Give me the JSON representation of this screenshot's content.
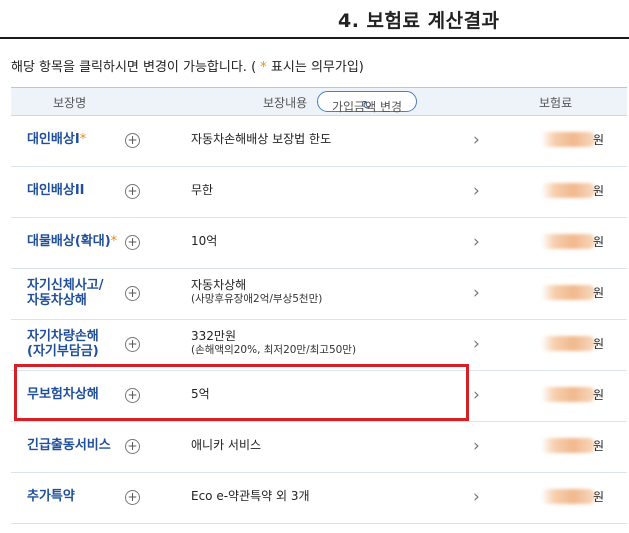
{
  "page_title": "4. 보험료 계산결과",
  "notice": {
    "prefix": "해당 항목을 클릭하시면 변경이 가능합니다. (",
    "star": " *",
    "suffix": " 표시는 의무가입)"
  },
  "table_header": {
    "name": "보장명",
    "content": "보장내용",
    "change_button": "가입금액 변경",
    "premium": "보험료"
  },
  "rows": [
    {
      "name": "대인배상I",
      "required": "*",
      "content": "자동차손해배상 보장법 한도",
      "sub": "",
      "unit": "원"
    },
    {
      "name": "대인배상II",
      "required": "",
      "content": "무한",
      "sub": "",
      "unit": "원"
    },
    {
      "name": "대물배상(확대)",
      "required": "*",
      "content": "10억",
      "sub": "",
      "unit": "원"
    },
    {
      "name": "자기신체사고/",
      "name2": "자동차상해",
      "required": "",
      "content": "자동차상해",
      "sub": "(사망후유장애2억/부상5천만)",
      "unit": "원"
    },
    {
      "name": "자기차량손해",
      "name2": "(자기부담금)",
      "required": "",
      "content": "332만원",
      "sub": "(손해액의20%, 최저20만/최고50만)",
      "unit": "원"
    },
    {
      "name": "무보험차상해",
      "required": "",
      "content": "5억",
      "sub": "",
      "unit": "원"
    },
    {
      "name": "긴급출동서비스",
      "required": "",
      "content": "애니카 서비스",
      "sub": "",
      "unit": "원"
    },
    {
      "name": "추가특약",
      "required": "",
      "content": "Eco e-약관특약 외 3개",
      "sub": "",
      "unit": "원"
    }
  ],
  "icons": {
    "expand": "plus-circle-icon",
    "chevron": "chevron-right-icon",
    "refresh": "refresh-icon"
  },
  "colors": {
    "name_text": "#1f4f9a",
    "required_star": "#e88a16",
    "highlight_border": "#d62027"
  }
}
